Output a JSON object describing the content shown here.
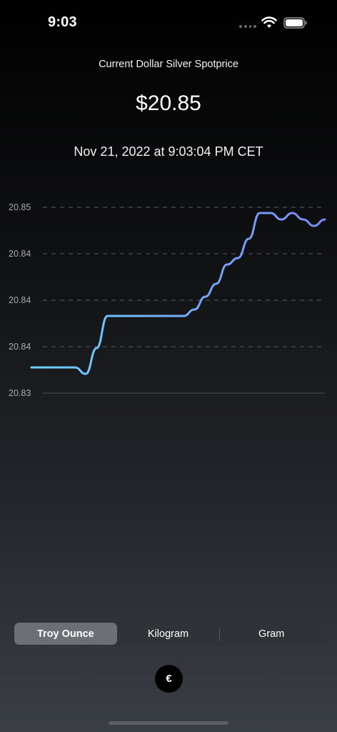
{
  "status": {
    "time": "9:03"
  },
  "header": {
    "subtitle": "Current Dollar Silver Spotprice",
    "price": "$20.85",
    "timestamp": "Nov 21, 2022 at 9:03:04 PM CET"
  },
  "chart_data": {
    "type": "line",
    "y_tick_labels": [
      "20.85",
      "20.84",
      "20.84",
      "20.84",
      "20.83"
    ],
    "grid": "dashed horizontal",
    "gradient_colors": [
      "#6ad2ff",
      "#7b88f5"
    ],
    "series": [
      {
        "values": [
          20.834,
          20.834,
          20.834,
          20.834,
          20.834,
          20.8335,
          20.8355,
          20.838,
          20.838,
          20.838,
          20.838,
          20.838,
          20.838,
          20.838,
          20.838,
          20.8385,
          20.8395,
          20.8405,
          20.842,
          20.8425,
          20.844,
          20.846,
          20.846,
          20.8455,
          20.846,
          20.8455,
          20.845,
          20.8455
        ]
      }
    ]
  },
  "units": {
    "options": [
      "Troy Ounce",
      "Kilogram",
      "Gram"
    ],
    "selected": "Troy Ounce"
  },
  "currency_button": {
    "label": "€"
  }
}
